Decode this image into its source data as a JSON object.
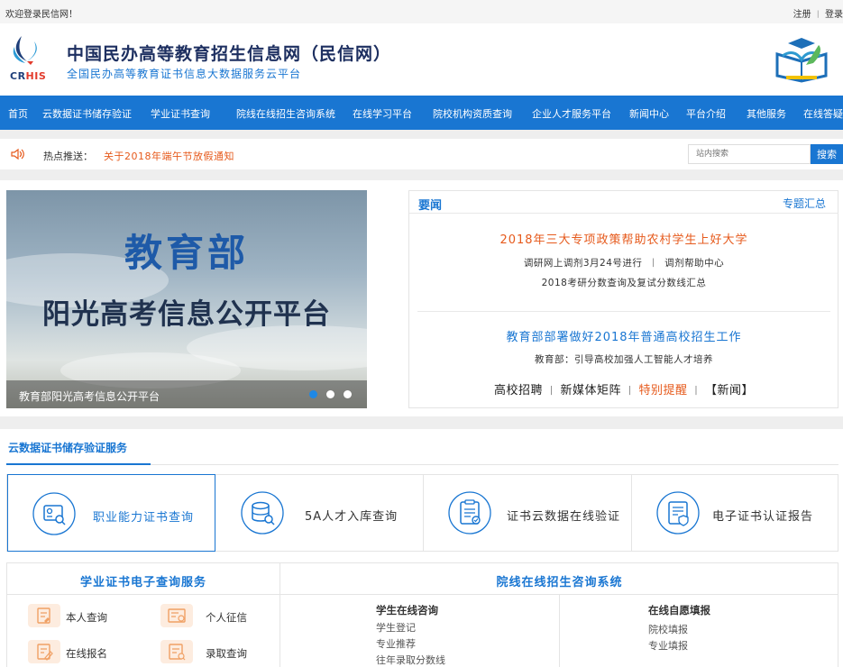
{
  "topbar": {
    "welcome": "欢迎登录民信网！",
    "register": "注册",
    "sep": "丨",
    "login": "登录"
  },
  "header": {
    "logo_text_a": "CR",
    "logo_text_b": "HIS",
    "title": "中国民办高等教育招生信息网（民信网）",
    "subtitle": "全国民办高等教育证书信息大数据服务云平台"
  },
  "nav": [
    "首页",
    "云数据证书储存验证",
    "学业证书查询",
    "院线在线招生咨询系统",
    "在线学习平台",
    "院校机构资质查询",
    "企业人才服务平台",
    "新闻中心",
    "平台介绍",
    "其他服务",
    "在线答疑"
  ],
  "hot": {
    "label": "热点推送：",
    "link": "关于2018年端午节放假通知"
  },
  "search": {
    "placeholder": "站内搜索",
    "button": "搜索"
  },
  "banner": {
    "big": "教育部",
    "mid": "阳光高考信息公开平台",
    "caption": "教育部阳光高考信息公开平台",
    "active_slide": 1,
    "slide_count": 3
  },
  "news": {
    "title": "要闻",
    "more": "专题汇总",
    "h1": "2018年三大专项政策帮助农村学生上好大学",
    "h1a_left": "调研网上调剂3月24号进行",
    "h1a_sep": "丨",
    "h1a_right": "调剂帮助中心",
    "h1b": "2018考研分数查询及复试分数线汇总",
    "h2": "教育部部署做好2018年普通高校招生工作",
    "h2a": "教育部：引导高校加强人工智能人才培养",
    "links": [
      "高校招聘",
      "新媒体矩阵",
      "特别提醒",
      "【新闻】"
    ],
    "link_sep": "丨"
  },
  "cloud": {
    "title": "云数据证书储存验证服务",
    "cards": [
      {
        "label": "职业能力证书查询",
        "icon": "certificate-search-icon"
      },
      {
        "label": "5A人才入库查询",
        "icon": "database-search-icon"
      },
      {
        "label": "证书云数据在线验证",
        "icon": "clipboard-verify-icon"
      },
      {
        "label": "电子证书认证报告",
        "icon": "report-shield-icon"
      }
    ]
  },
  "academic": {
    "title": "学业证书电子查询服务",
    "items": [
      {
        "label": "本人查询",
        "icon": "self-query-icon"
      },
      {
        "label": "个人征信",
        "icon": "credit-icon"
      },
      {
        "label": "在线报名",
        "icon": "signup-icon"
      },
      {
        "label": "录取查询",
        "icon": "admission-query-icon"
      }
    ]
  },
  "consult": {
    "title": "院线在线招生咨询系统",
    "col1": {
      "title": "学生在线咨询",
      "items": [
        "学生登记",
        "专业推荐",
        "往年录取分数线"
      ]
    },
    "col2": {
      "title": "在线自愿填报",
      "items": [
        "院校填报",
        "专业填报"
      ]
    }
  },
  "colors": {
    "primary": "#1976d2",
    "accent": "#e65a1c",
    "brand_red": "#e23b2c"
  }
}
